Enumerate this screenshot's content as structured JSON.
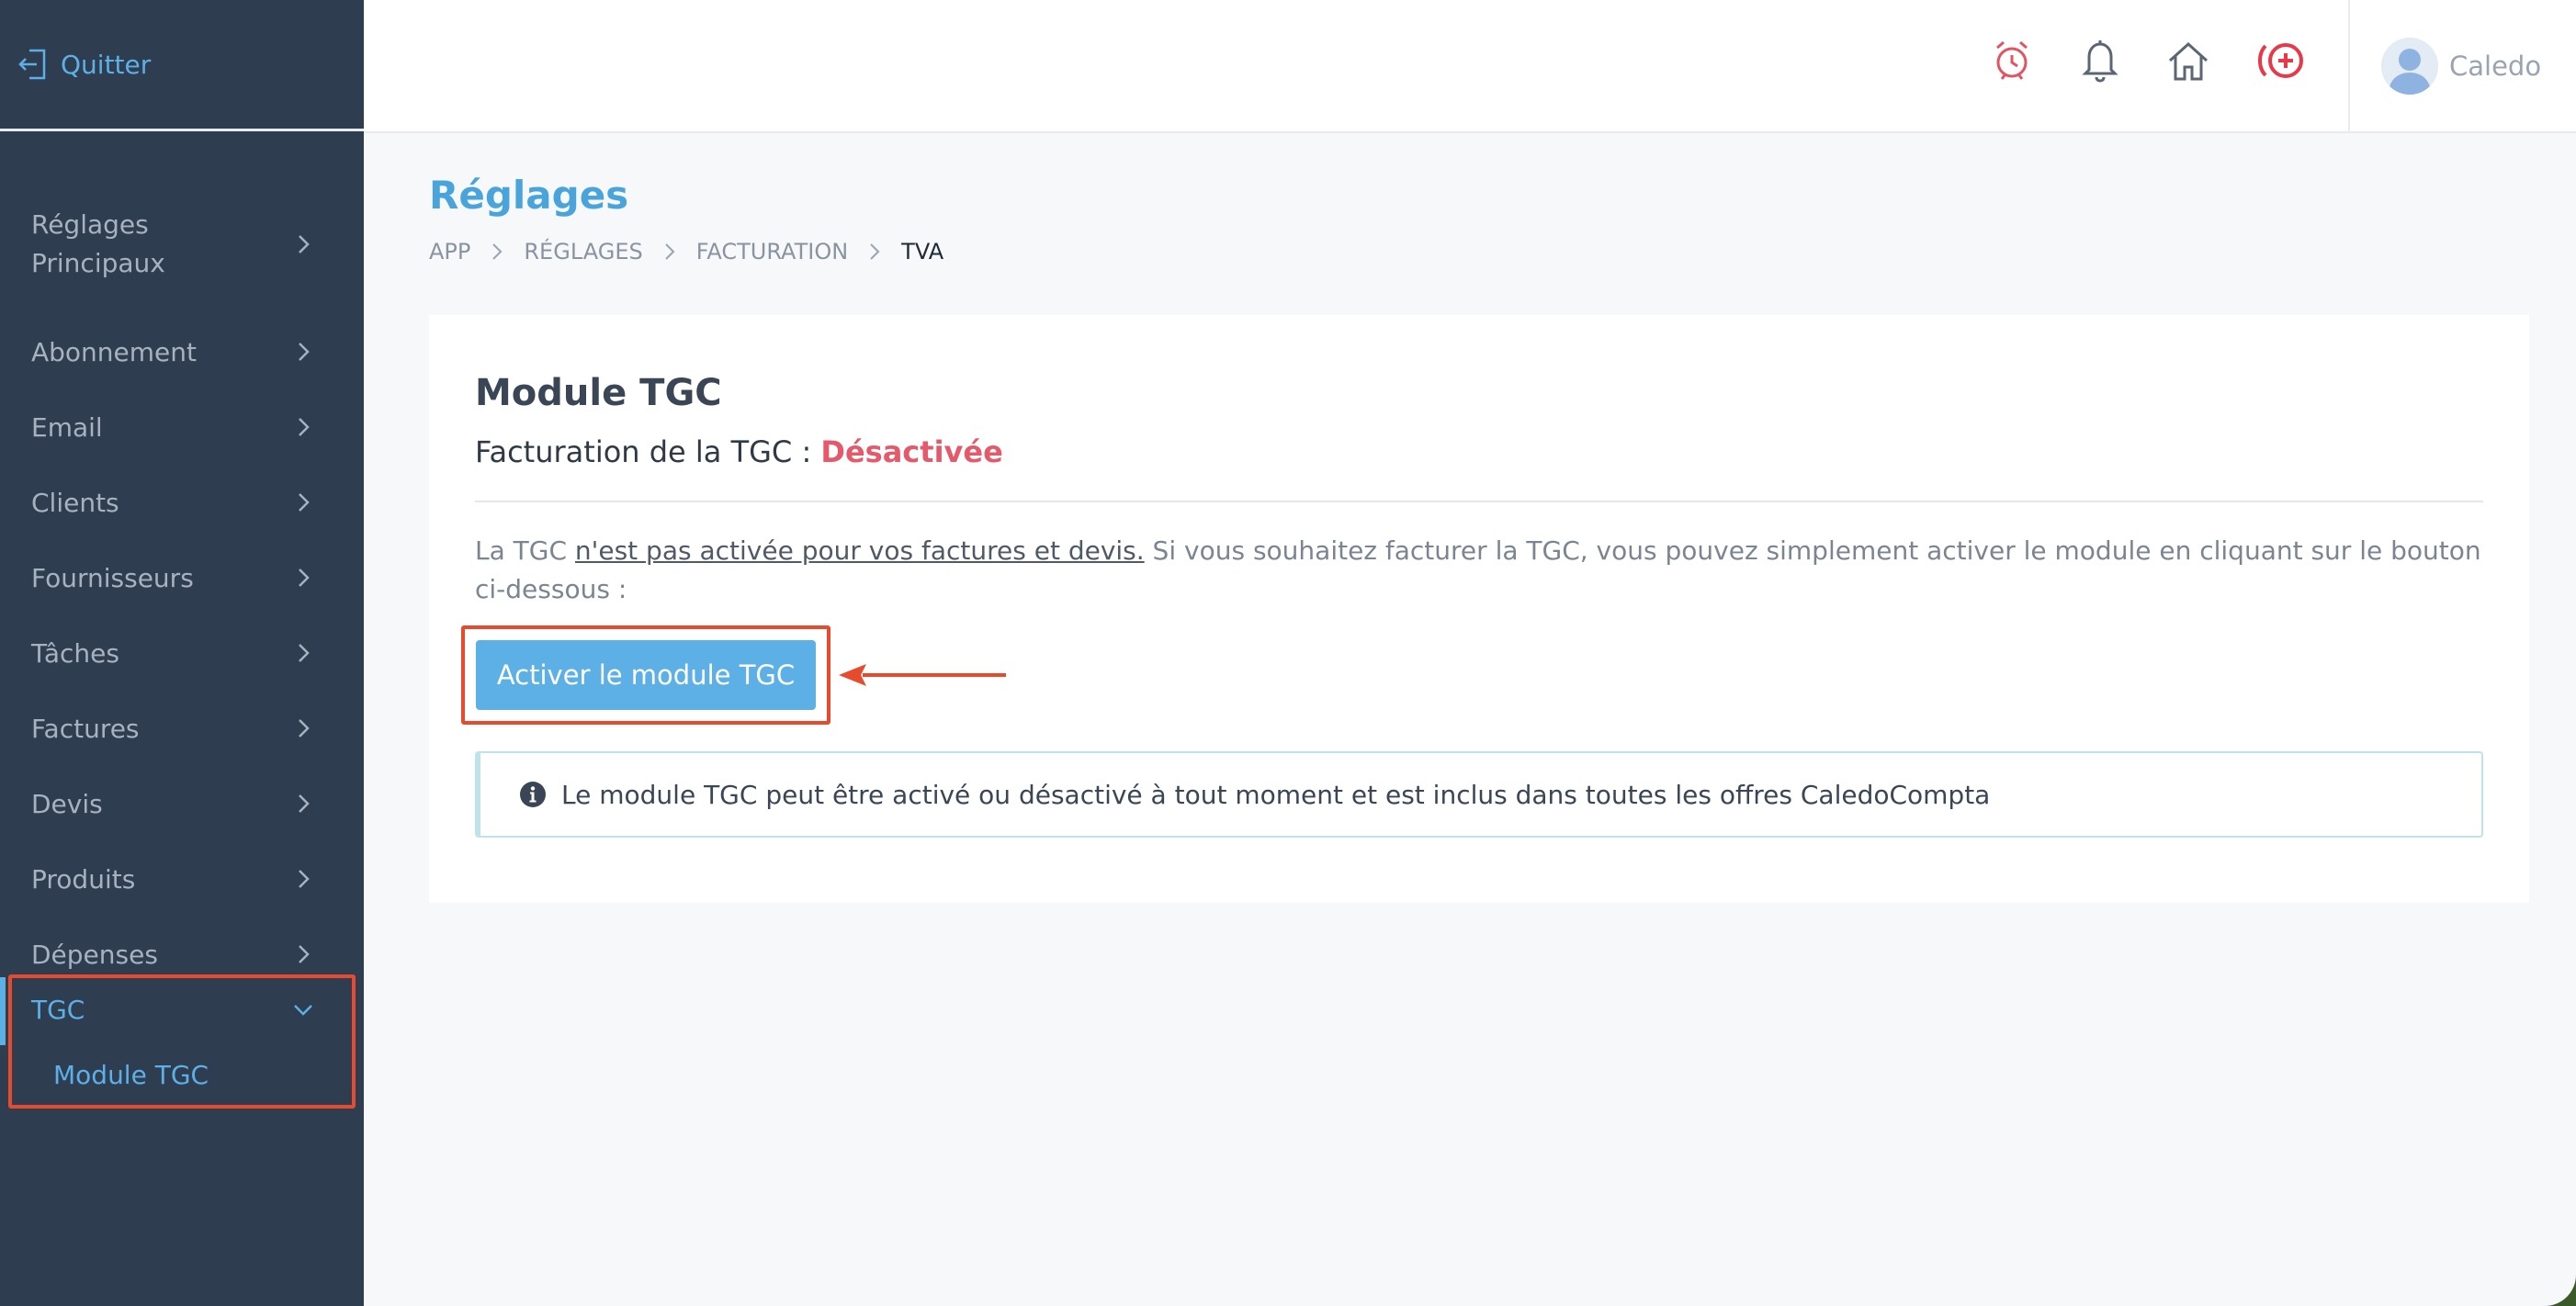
{
  "colors": {
    "accent": "#5cb0e6",
    "sidebar_bg": "#2f3d50",
    "status_disabled": "#e55a6b",
    "highlight": "#e64b2e"
  },
  "sidebar": {
    "quit_label": "Quitter",
    "items": [
      {
        "label": "Réglages Principaux",
        "icon": "chevron-right-icon"
      },
      {
        "label": "Abonnement",
        "icon": "chevron-right-icon"
      },
      {
        "label": "Email",
        "icon": "chevron-right-icon"
      },
      {
        "label": "Clients",
        "icon": "chevron-right-icon"
      },
      {
        "label": "Fournisseurs",
        "icon": "chevron-right-icon"
      },
      {
        "label": "Tâches",
        "icon": "chevron-right-icon"
      },
      {
        "label": "Factures",
        "icon": "chevron-right-icon"
      },
      {
        "label": "Devis",
        "icon": "chevron-right-icon"
      },
      {
        "label": "Produits",
        "icon": "chevron-right-icon"
      },
      {
        "label": "Dépenses",
        "icon": "chevron-right-icon"
      }
    ],
    "active_group": {
      "label": "TGC",
      "icon": "chevron-down-icon",
      "sub_item": "Module TGC"
    }
  },
  "header": {
    "icons": [
      "alarm-clock-icon",
      "bell-icon",
      "home-icon",
      "add-circle-icon"
    ],
    "user_name": "Caledo"
  },
  "page": {
    "title": "Réglages",
    "breadcrumb": [
      "APP",
      "RÉGLAGES",
      "FACTURATION",
      "TVA"
    ]
  },
  "card": {
    "title": "Module TGC",
    "subtitle_prefix": "Facturation de la TGC : ",
    "status": "Désactivée",
    "text_prefix": "La TGC ",
    "text_underlined": "n'est pas activée pour vos factures et devis.",
    "text_suffix": " Si vous souhaitez facturer la TGC, vous pouvez simplement activer le module en cliquant sur le bouton ci-dessous :",
    "button_label": "Activer le module TGC",
    "info_text": "Le module TGC peut être activé ou désactivé à tout moment et est inclus dans toutes les offres CaledoCompta"
  }
}
